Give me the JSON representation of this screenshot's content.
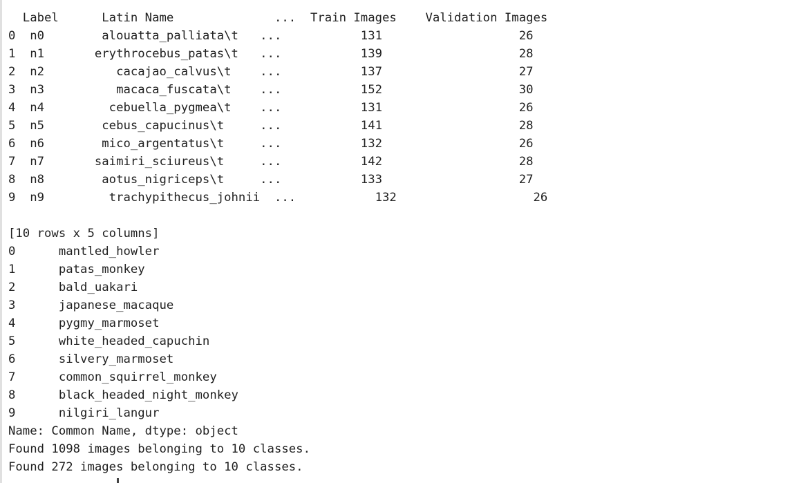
{
  "output": {
    "dataframe_header": "  Label      Latin Name              ...  Train Images    Validation Images",
    "dataframe_rows": [
      "0  n0        alouatta_palliata\\t   ...           131                   26",
      "1  n1       erythrocebus_patas\\t   ...           139                   28",
      "2  n2          cacajao_calvus\\t    ...           137                   27",
      "3  n3          macaca_fuscata\\t    ...           152                   30",
      "4  n4         cebuella_pygmea\\t    ...           131                   26",
      "5  n5        cebus_capucinus\\t     ...           141                   28",
      "6  n6        mico_argentatus\\t     ...           132                   26",
      "7  n7       saimiri_sciureus\\t     ...           142                   28",
      "8  n8        aotus_nigriceps\\t     ...           133                   27",
      "9  n9         trachypithecus_johnii  ...           132                   26"
    ],
    "blank": "",
    "shape_note": "[10 rows x 5 columns]",
    "series_rows": [
      "0      mantled_howler",
      "1      patas_monkey",
      "2      bald_uakari",
      "3      japanese_macaque",
      "4      pygmy_marmoset",
      "5      white_headed_capuchin",
      "6      silvery_marmoset",
      "7      common_squirrel_monkey",
      "8      black_headed_night_monkey",
      "9      nilgiri_langur"
    ],
    "series_footer": "Name: Common Name, dtype: object",
    "found_train": "Found 1098 images belonging to 10 classes.",
    "found_validation": "Found 272 images belonging to 10 classes."
  }
}
